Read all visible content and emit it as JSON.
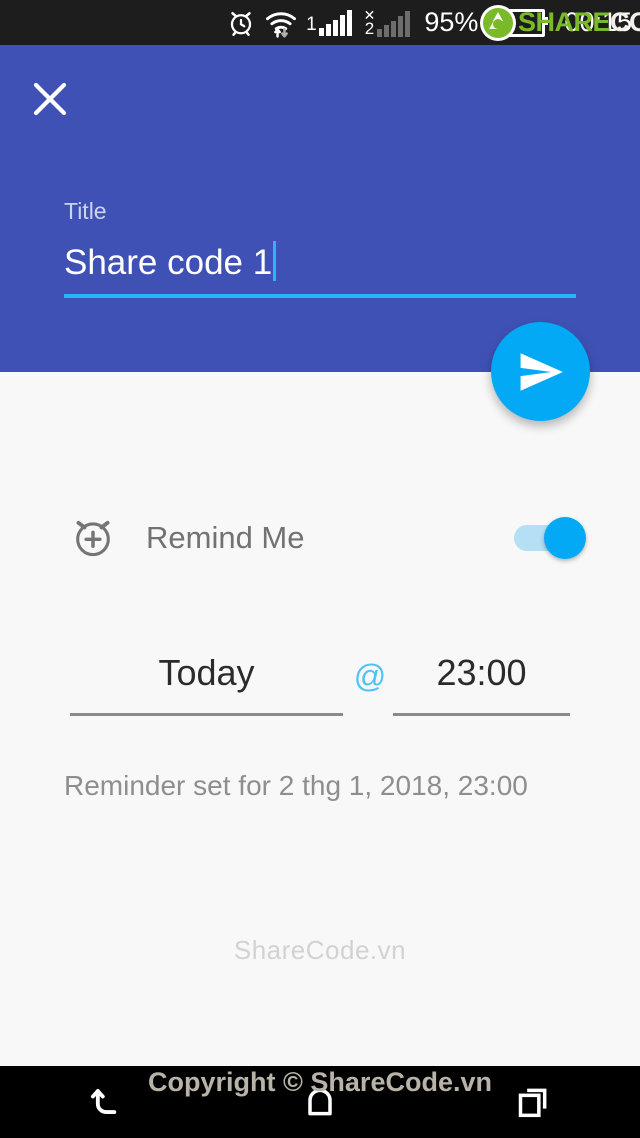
{
  "status_bar": {
    "icons": [
      "alarm-icon",
      "wifi-icon",
      "signal-sim1-icon",
      "signal-sim2-icon"
    ],
    "sim1_label": "1",
    "sim2_label": "2",
    "battery_percent": "95%",
    "clock": "00:15",
    "background_color": "#1d1d1d"
  },
  "watermarks": {
    "logo_green": "SHARE",
    "logo_white": "CODE.vn",
    "body": "ShareCode.vn",
    "footer": "Copyright © ShareCode.vn"
  },
  "header": {
    "background_color": "#3f51b5",
    "close_label": "Close",
    "title_label": "Title",
    "title_value": "Share code 1",
    "title_placeholder": "Title",
    "accent_color": "#29b6f6"
  },
  "fab": {
    "label": "Send",
    "icon": "send-icon",
    "color": "#03a9f4"
  },
  "reminder": {
    "icon": "alarm-add-icon",
    "label": "Remind Me",
    "toggle_on": true,
    "toggle_color": "#03a9f4",
    "date_value": "Today",
    "separator": "@",
    "time_value": "23:00",
    "status_text": "Reminder set for 2 thg 1, 2018, 23:00"
  },
  "nav_bar": {
    "back_label": "Back",
    "home_label": "Home",
    "recents_label": "Recents",
    "background_color": "#000000"
  }
}
